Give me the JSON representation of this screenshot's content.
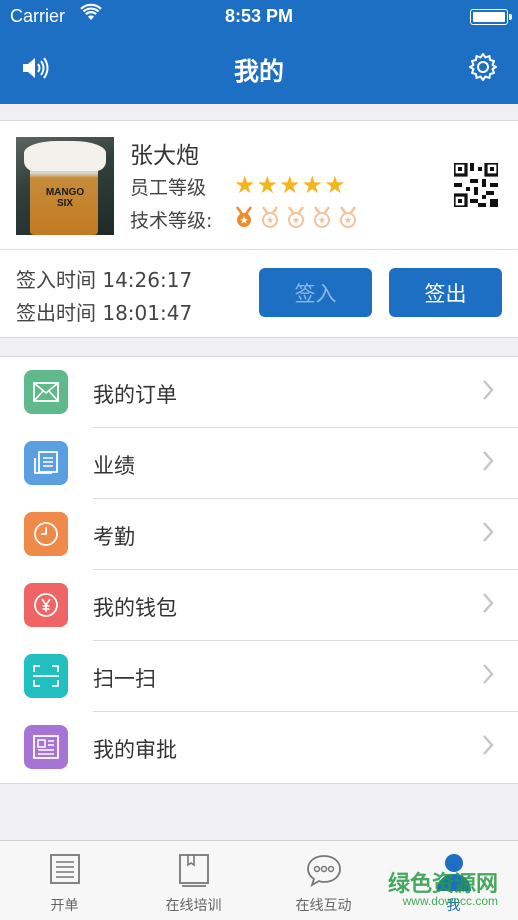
{
  "status_bar": {
    "carrier": "Carrier",
    "time": "8:53 PM"
  },
  "navbar": {
    "title": "我的",
    "left_icon": "speaker-icon",
    "right_icon": "gear-icon"
  },
  "profile": {
    "name": "张大炮",
    "employee_level_label": "员工等级",
    "employee_stars": 5,
    "tech_level_label": "技术等级:",
    "tech_medals_total": 5,
    "tech_medals_active": 1,
    "avatar_text_1": "MANGO",
    "avatar_text_2": "SIX",
    "sign_in_time": "签入时间 14:26:17",
    "sign_out_time": "签出时间 18:01:47",
    "sign_in_button": "签入",
    "sign_out_button": "签出"
  },
  "menu": [
    {
      "label": "我的订单",
      "icon": "envelope-icon",
      "color": "#5fb98a"
    },
    {
      "label": "业绩",
      "icon": "document-icon",
      "color": "#5b9fe0"
    },
    {
      "label": "考勤",
      "icon": "clock-icon",
      "color": "#f08a4a"
    },
    {
      "label": "我的钱包",
      "icon": "yen-icon",
      "color": "#ef6566"
    },
    {
      "label": "扫一扫",
      "icon": "scan-icon",
      "color": "#22bfc0"
    },
    {
      "label": "我的审批",
      "icon": "approval-icon",
      "color": "#a574d4"
    }
  ],
  "tabbar": [
    {
      "label": "开单",
      "icon": "list-icon"
    },
    {
      "label": "在线培训",
      "icon": "book-icon"
    },
    {
      "label": "在线互动",
      "icon": "chat-icon"
    },
    {
      "label": "我",
      "icon": "user-icon",
      "active": true
    }
  ],
  "watermark": {
    "text": "绿色资源网",
    "url": "www.downcc.com"
  }
}
